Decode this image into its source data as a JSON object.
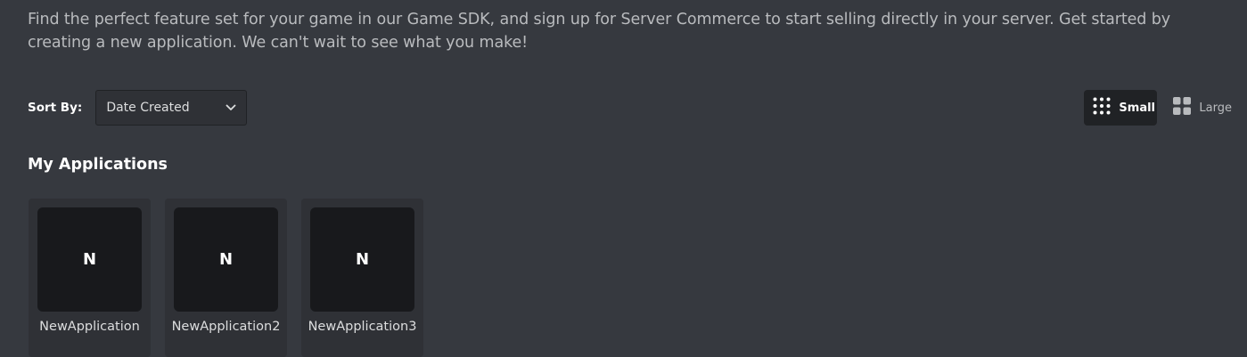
{
  "description": "Find the perfect feature set for your game in our Game SDK, and sign up for Server Commerce to start selling directly in your server. Get started by creating a new application. We can't wait to see what you make!",
  "sort": {
    "label": "Sort By:",
    "selected": "Date Created"
  },
  "view_toggle": {
    "small_label": "Small",
    "large_label": "Large",
    "active": "Small"
  },
  "section_title": "My Applications",
  "applications": [
    {
      "initial": "N",
      "name": "NewApplication"
    },
    {
      "initial": "N",
      "name": "NewApplication2"
    },
    {
      "initial": "N",
      "name": "NewApplication3"
    }
  ],
  "colors": {
    "background": "#36393f",
    "card": "#2f3136",
    "icon_bg": "#18191c",
    "active_toggle": "#202225"
  }
}
